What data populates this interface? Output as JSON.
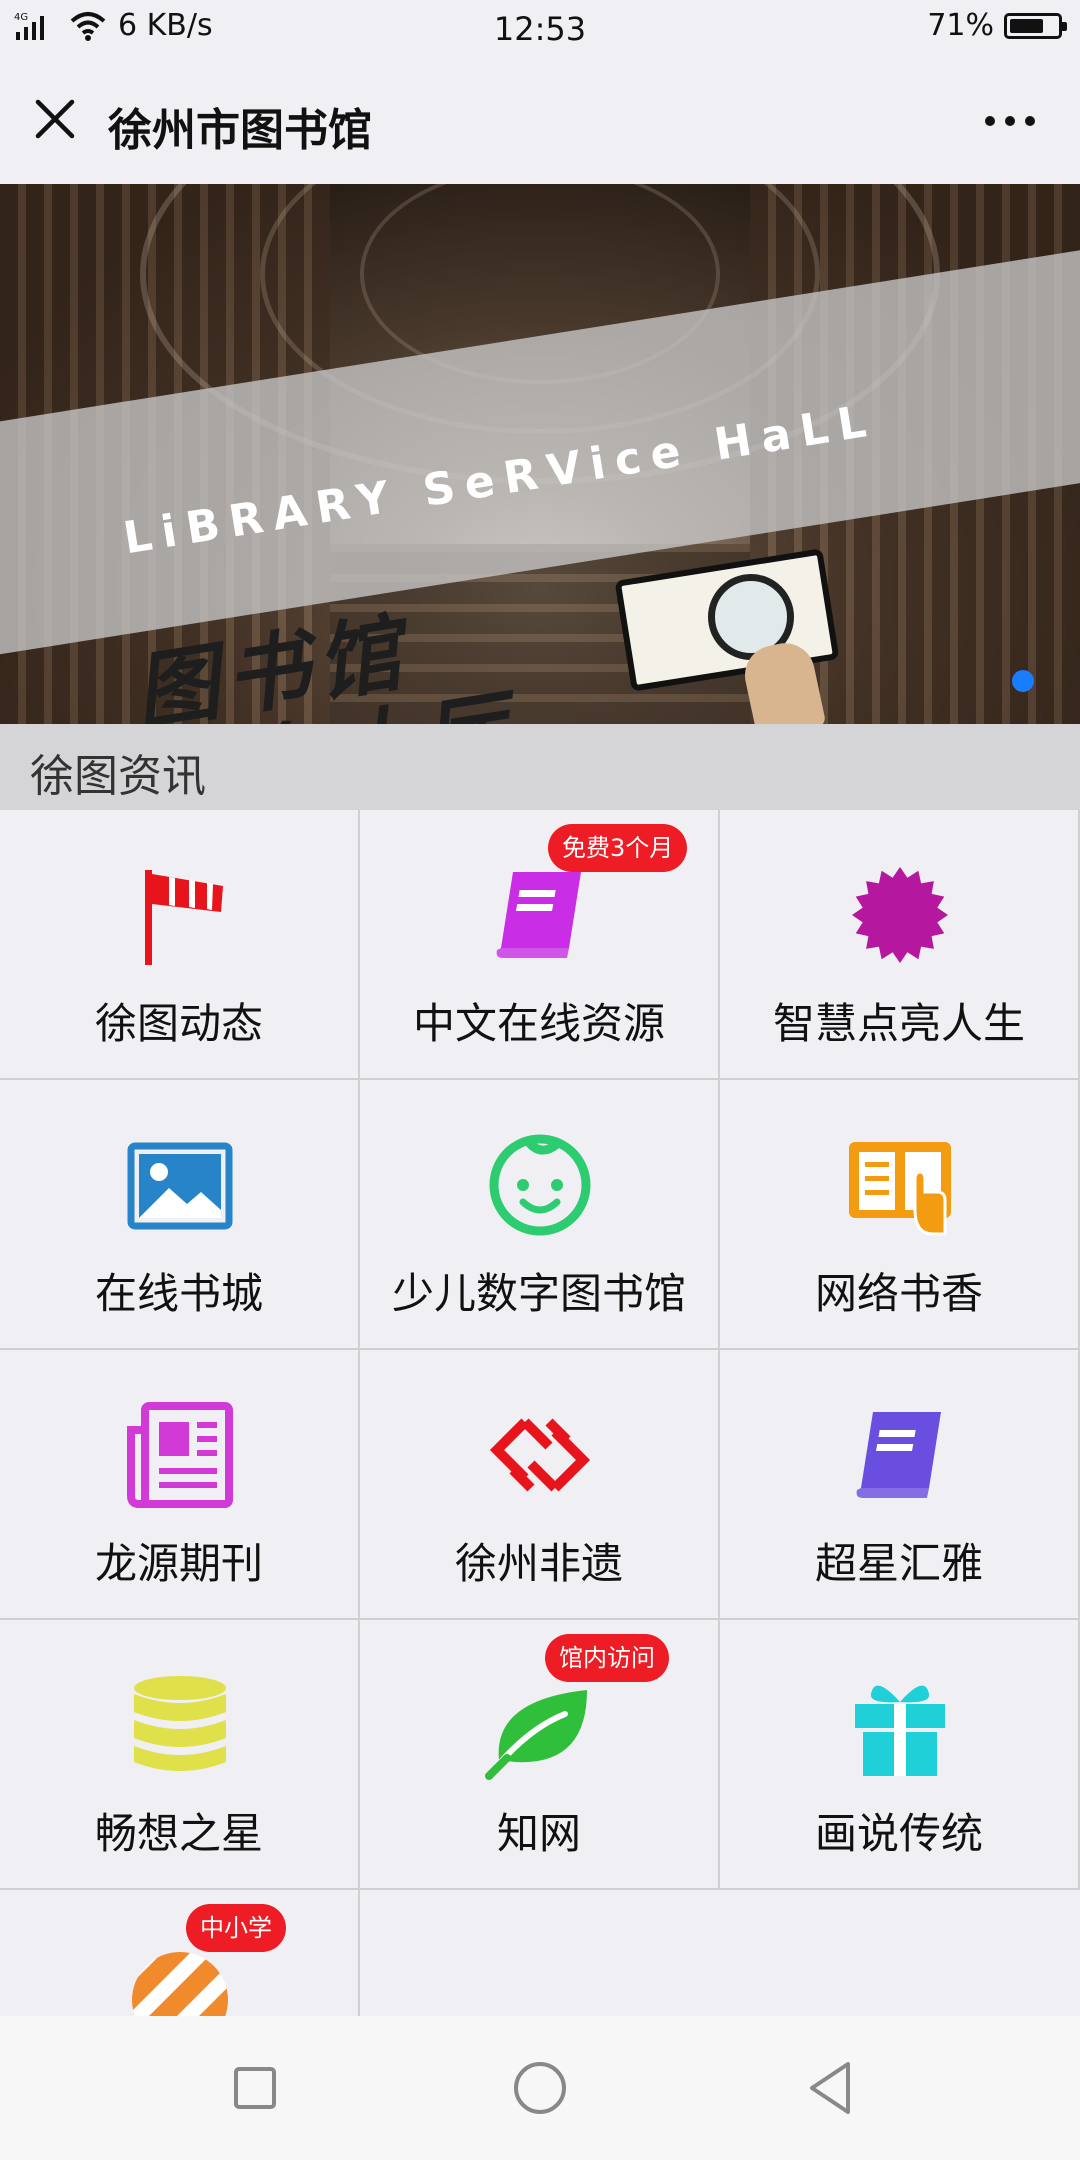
{
  "status_bar": {
    "network": "4G",
    "speed": "6 KB/s",
    "time": "12:53",
    "battery": "71%",
    "battery_level": 0.71
  },
  "header": {
    "title": "徐州市图书馆",
    "close_icon": "close-icon",
    "more_icon": "more-dots-icon"
  },
  "banner": {
    "en_text": "LiBRARY SeRVice HaLL",
    "cn_line1": "图书馆",
    "cn_line2": "服务大厅",
    "active_indicator": 1,
    "indicator_color": "#1a7cff"
  },
  "section": {
    "title": "徐图资讯"
  },
  "grid_items": [
    {
      "label": "徐图动态",
      "icon": "windsock-icon",
      "color": "#e8141c",
      "badge": ""
    },
    {
      "label": "中文在线资源",
      "icon": "book-icon",
      "color": "#c92ee6",
      "badge": "免费3个月"
    },
    {
      "label": "智慧点亮人生",
      "icon": "starburst-icon",
      "color": "#b5179e",
      "badge": ""
    },
    {
      "label": "在线书城",
      "icon": "image-icon",
      "color": "#2784c9",
      "badge": ""
    },
    {
      "label": "少儿数字图书馆",
      "icon": "baby-face-icon",
      "color": "#2ecc71",
      "badge": ""
    },
    {
      "label": "网络书香",
      "icon": "reader-hand-icon",
      "color": "#f39c12",
      "badge": ""
    },
    {
      "label": "龙源期刊",
      "icon": "newspaper-icon",
      "color": "#d23ad7",
      "badge": ""
    },
    {
      "label": "徐州非遗",
      "icon": "link-diamond-icon",
      "color": "#e8141c",
      "badge": ""
    },
    {
      "label": "超星汇雅",
      "icon": "book-icon",
      "color": "#6a4ee0",
      "badge": ""
    },
    {
      "label": "畅想之星",
      "icon": "database-icon",
      "color": "#dfe04a",
      "badge": ""
    },
    {
      "label": "知网",
      "icon": "leaf-icon",
      "color": "#2fbf3a",
      "badge": "馆内访问"
    },
    {
      "label": "画说传统",
      "icon": "gift-icon",
      "color": "#1fd0d8",
      "badge": ""
    },
    {
      "label": "",
      "icon": "striped-ball-icon",
      "color": "#f08a2c",
      "badge": "中小学"
    }
  ],
  "nav_bar": {
    "recents_icon": "square-icon",
    "home_icon": "circle-icon",
    "back_icon": "triangle-back-icon"
  }
}
